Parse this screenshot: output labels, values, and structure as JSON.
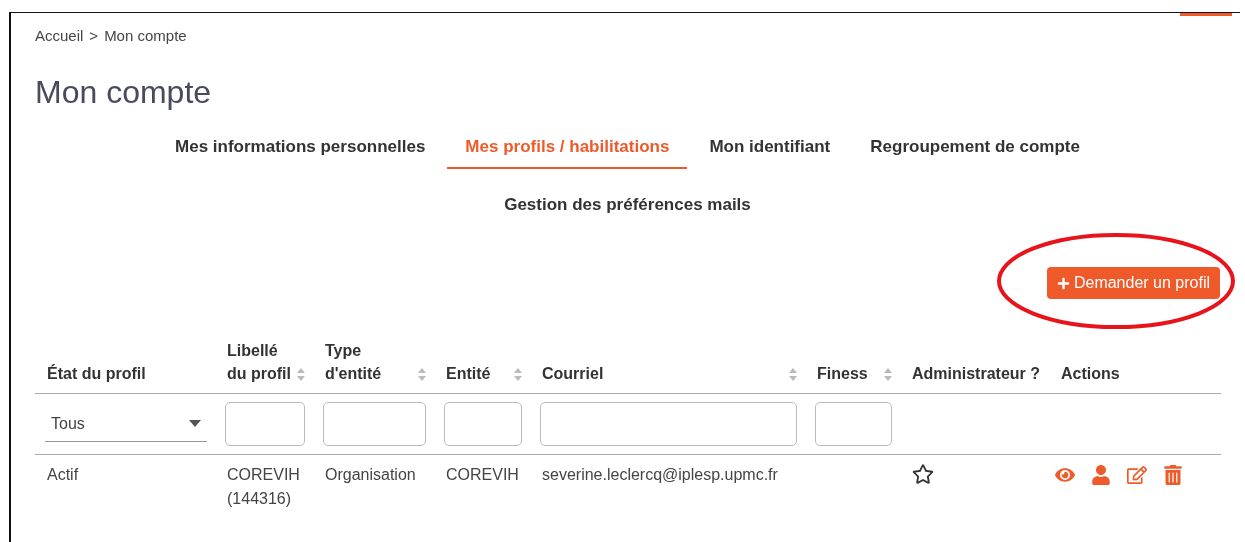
{
  "breadcrumb": {
    "items": [
      {
        "label": "Accueil"
      },
      {
        "label": "Mon compte"
      }
    ],
    "separator": ">"
  },
  "title": "Mon compte",
  "tabs": [
    {
      "label": "Mes informations personnelles",
      "selected": false
    },
    {
      "label": "Mes profils / habilitations",
      "selected": true
    },
    {
      "label": "Mon identifiant",
      "selected": false
    },
    {
      "label": "Regroupement de compte",
      "selected": false
    },
    {
      "label": "Gestion des préférences mails",
      "selected": false
    }
  ],
  "request_button": {
    "label": "Demander un profil"
  },
  "table": {
    "columns": [
      {
        "label": "État du profil",
        "sortable": false,
        "filter": {
          "kind": "select",
          "value": "Tous"
        }
      },
      {
        "label": "Libellé du profil",
        "sortable": true,
        "filter": {
          "kind": "text"
        }
      },
      {
        "label": "Type d'entité",
        "sortable": true,
        "filter": {
          "kind": "text"
        }
      },
      {
        "label": "Entité",
        "sortable": true,
        "filter": {
          "kind": "text"
        }
      },
      {
        "label": "Courriel",
        "sortable": true,
        "filter": {
          "kind": "text"
        }
      },
      {
        "label": "Finess",
        "sortable": true,
        "filter": {
          "kind": "text"
        }
      },
      {
        "label": "Administrateur ?",
        "sortable": false,
        "filter": {
          "kind": "none"
        }
      },
      {
        "label": "Actions",
        "sortable": false,
        "filter": {
          "kind": "none"
        }
      }
    ],
    "rows": [
      {
        "status": "Actif",
        "profile": "COREVIH (144316)",
        "entity_type": "Organisation",
        "entity": "COREVIH",
        "email": "severine.leclercq@iplesp.upmc.fr",
        "administrator": false
      }
    ]
  }
}
